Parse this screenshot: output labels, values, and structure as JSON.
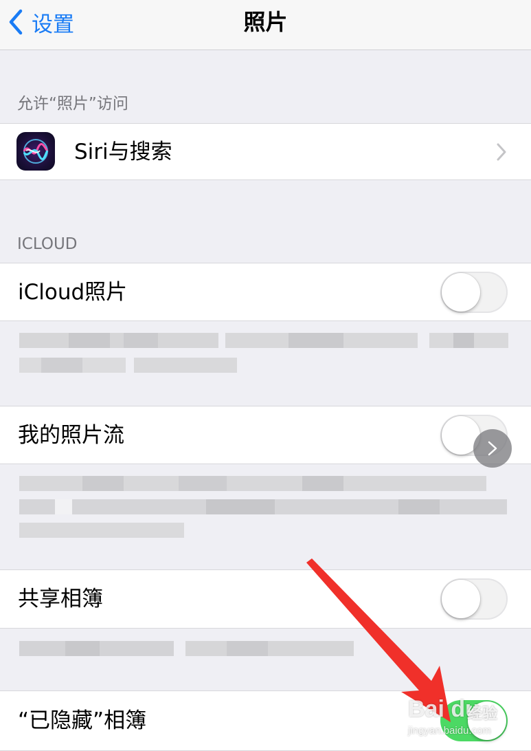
{
  "nav": {
    "back_label": "设置",
    "title": "照片"
  },
  "sections": {
    "allow_access_header": "允许“照片”访问",
    "icloud_header": "ICLOUD"
  },
  "rows": {
    "siri": {
      "label": "Siri与搜索",
      "icon": "siri-icon",
      "accessory": "chevron-right-icon"
    },
    "icloud_photos": {
      "label": "iCloud照片",
      "toggle_on": false
    },
    "my_photo_stream": {
      "label": "我的照片流",
      "toggle_on": false
    },
    "shared_albums": {
      "label": "共享相簿",
      "toggle_on": false
    },
    "hidden_album": {
      "label": "“已隐藏”相簿",
      "toggle_on": true
    }
  },
  "watermark": {
    "logo": "Bai du",
    "sub": "经验",
    "url": "jingyan.baidu.com"
  },
  "colors": {
    "accent": "#1a7cf5",
    "toggle_on": "#4cd964",
    "background": "#efeff4",
    "annotation_arrow": "#f0302a"
  }
}
